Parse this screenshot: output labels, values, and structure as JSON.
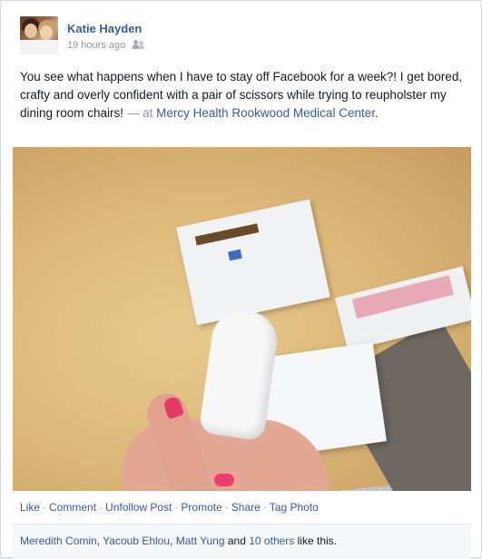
{
  "post": {
    "author": "Katie Hayden",
    "timestamp": "19 hours ago",
    "privacy_icon": "friends-icon",
    "text": "You see what happens when I have to stay off Facebook for a week?! I get bored, crafty and overly confident with a pair of scissors while trying to reupholster my dining room chairs!",
    "location_prefix": "— at",
    "location": "Mercy Health Rookwood Medical Center",
    "location_suffix": ".",
    "photo": {
      "icon": "post-photo"
    }
  },
  "actions": {
    "like": "Like",
    "comment": "Comment",
    "unfollow": "Unfollow Post",
    "promote": "Promote",
    "share": "Share",
    "tag_photo": "Tag Photo",
    "separator": "·"
  },
  "likes": {
    "person1": "Meredith Comin",
    "person2": "Yacoub Ehlou",
    "person3": "Matt Yung",
    "sep1": ",",
    "sep2": ",",
    "and_text": "and",
    "others": "10 others",
    "suffix": "like this."
  },
  "colors": {
    "link": "#3b5998",
    "meta": "#90949c",
    "text": "#141823",
    "nail_polish": "#e53a63"
  }
}
